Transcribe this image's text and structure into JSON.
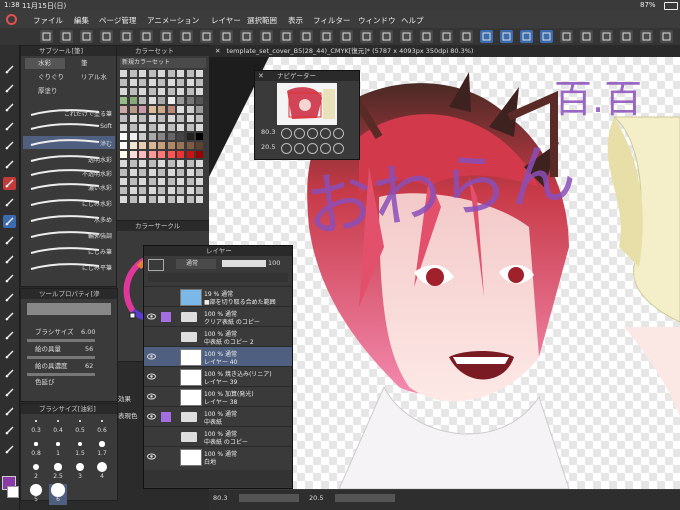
{
  "status": {
    "time": "1:38",
    "date": "11月15日(日)",
    "battery": "87%"
  },
  "menu": [
    "ファイル",
    "編集",
    "ページ管理",
    "アニメーション",
    "レイヤー",
    "選択範囲",
    "表示",
    "フィルター",
    "ウィンドウ",
    "ヘルプ"
  ],
  "subtool_panel": {
    "title": "サブツール[筆]",
    "tabs": [
      "水彩",
      "筆",
      "ぐりぐり",
      "リアル水",
      "厚塗り"
    ],
    "brushes": [
      "これだけで塗る筆",
      "Soft",
      "滲む",
      "透明水彩",
      "不透明水彩",
      "濃い水彩",
      "にじみ水彩",
      "水多め",
      "輪郭強調",
      "にじみ筆",
      "にじみ平筆"
    ],
    "sizes_title": "ブラシサイズ[油彩]",
    "sizes": [
      "0.3",
      "0.4",
      "0.5",
      "0.6",
      "0.8",
      "1",
      "1.5",
      "1.7",
      "2",
      "2.5",
      "3",
      "4",
      "5",
      "6"
    ]
  },
  "tool_property": {
    "title": "ツールプロパティ[滲",
    "brush_size_label": "ブラシサイズ",
    "brush_size": "6.00",
    "density_label": "絵の具量",
    "density": "56",
    "opacity_label": "絵の具濃度",
    "opacity": "62",
    "blend_label": "色延び"
  },
  "color_set": {
    "title": "カラーセット",
    "set_name": "新規カラーセット"
  },
  "color_circle": {
    "title": "カラーサークル"
  },
  "layer_panel": {
    "title": "レイヤー",
    "blend_mode": "通常",
    "opacity": "100",
    "layers": [
      {
        "line1": "19 % 通常",
        "line2": "■部を切り取る合めた範囲"
      },
      {
        "line1": "100 % 通常",
        "line2": "クリア表紙 のコピー"
      },
      {
        "line1": "100 % 通常",
        "line2": "中表紙 のコピー 2"
      },
      {
        "line1": "100 % 通常",
        "line2": "レイヤー 40"
      },
      {
        "line1": "100 % 焼き込み(リニア)",
        "line2": "レイヤー 39"
      },
      {
        "line1": "100 % 加算(発光)",
        "line2": "レイヤー 38"
      },
      {
        "line1": "100 % 通常",
        "line2": "中表紙"
      },
      {
        "line1": "100 % 通常",
        "line2": "中表紙 のコピー"
      },
      {
        "line1": "100 % 通常",
        "line2": "白地"
      }
    ]
  },
  "navigator": {
    "title": "ナビゲーター",
    "zoom": "80.3",
    "rotate": "20.5"
  },
  "document_tab": "template_set_cover_B5(28_44)_CMYK[復元]* (5787 x 4093px 350dpi 80.3%)",
  "bottom": {
    "zoom": "80.3",
    "angle": "20.5"
  },
  "side_labels": {
    "effect": "効果",
    "display": "表現色"
  },
  "artwork_text": {
    "main": "おわらん",
    "small": "百.百"
  },
  "colors": {
    "accent": "#3b6cb0",
    "layer_highlight": "#a36ee0",
    "selected_layer": "#4f5f80"
  }
}
